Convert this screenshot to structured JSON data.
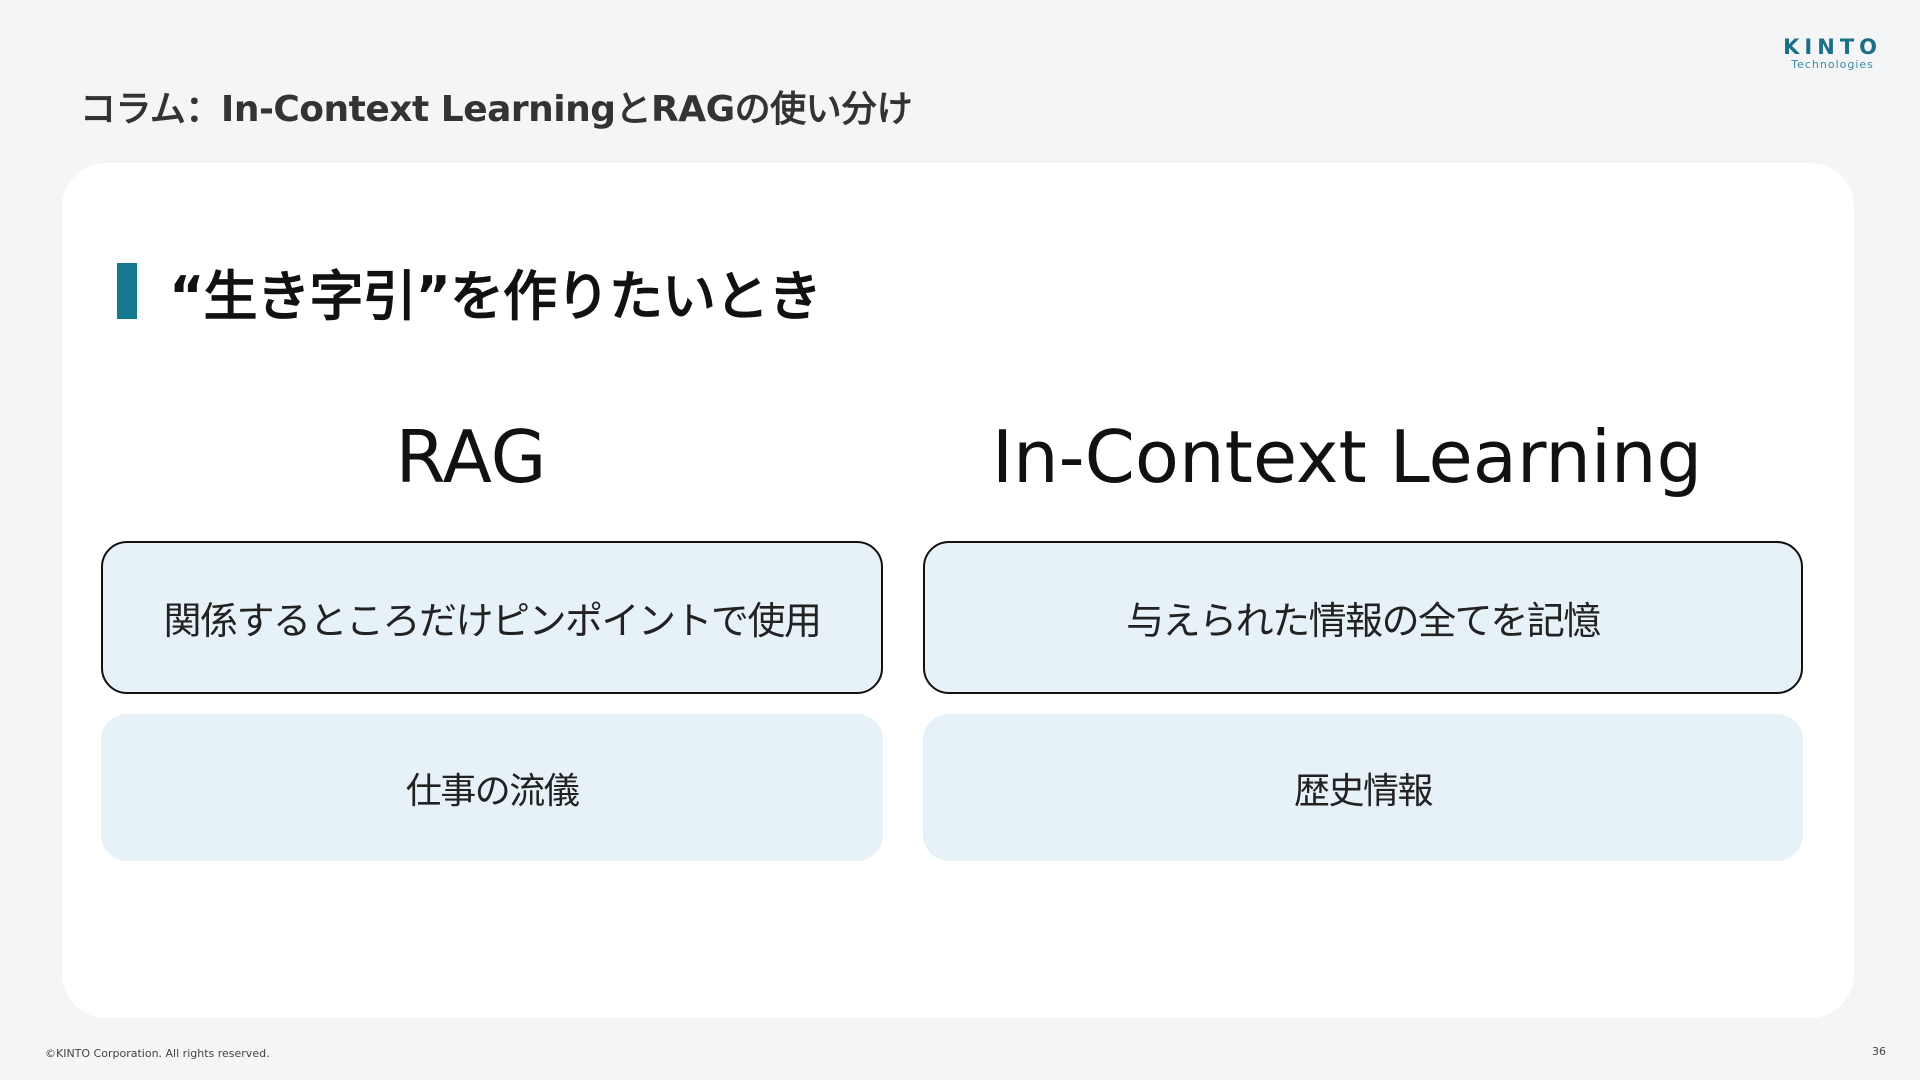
{
  "logo": {
    "main": "KINTO",
    "sub": "Technologies"
  },
  "slide": {
    "title": "コラム：In-Context LearningとRAGの使い分け",
    "section_title": "“生き字引”を作りたいとき"
  },
  "columns": {
    "left": {
      "title": "RAG",
      "row1": "関係するところだけピンポイントで使用",
      "row2": "仕事の流儀"
    },
    "right": {
      "title": "In-Context Learning",
      "row1": "与えられた情報の全てを記憶",
      "row2": "歴史情報"
    }
  },
  "footer": {
    "copyright": "©KINTO Corporation. All rights reserved.",
    "page_number": "36"
  },
  "colors": {
    "accent": "#14798f",
    "background": "#f3f5f7",
    "box_fill": "#e7f1f8"
  }
}
